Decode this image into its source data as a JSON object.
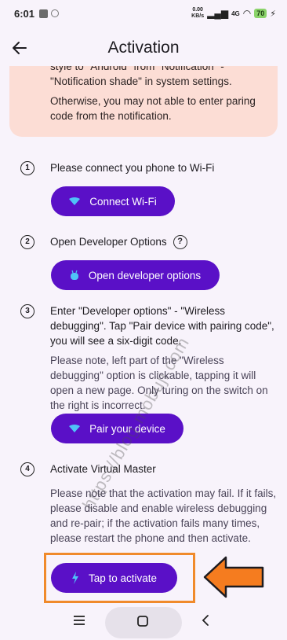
{
  "status_bar": {
    "time": "6:01",
    "net_speed_value": "0.00",
    "net_speed_unit": "KB/s",
    "signal": "4G",
    "battery": "70"
  },
  "app_bar": {
    "title": "Activation",
    "back_icon": "arrow-left-icon"
  },
  "warning": {
    "line1": "style to \"Android\" from \"Notification\" - \"Notification shade\" in system settings.",
    "line2": "Otherwise, you may not able to enter paring code from the notification."
  },
  "steps": [
    {
      "num": "1",
      "text": "Please connect you phone to Wi-Fi",
      "button": "Connect Wi-Fi"
    },
    {
      "num": "2",
      "text": "Open Developer Options",
      "help": "?",
      "button": "Open developer options"
    },
    {
      "num": "3",
      "text": "Enter \"Developer options\" - \"Wireless debugging\". Tap \"Pair device with pairing code\", you will see a six-digit code.",
      "note": "Please note, left part of the \"Wireless debugging\" option is clickable, tapping it will open a new page. Only turing on the switch on the right is incorrect.",
      "button": "Pair your device"
    },
    {
      "num": "4",
      "text": "Activate Virtual Master",
      "note": "Please note that the activation may fail. If it fails, please disable and enable wireless debugging and re-pair; if the activation fails many times, please restart the phone and then activate.",
      "button": "Tap to activate"
    }
  ],
  "watermark": "https://blog.mobuji.com",
  "colors": {
    "accent": "#5a10c7",
    "warning_bg": "#fcddd5",
    "highlight": "#f08a2b"
  }
}
